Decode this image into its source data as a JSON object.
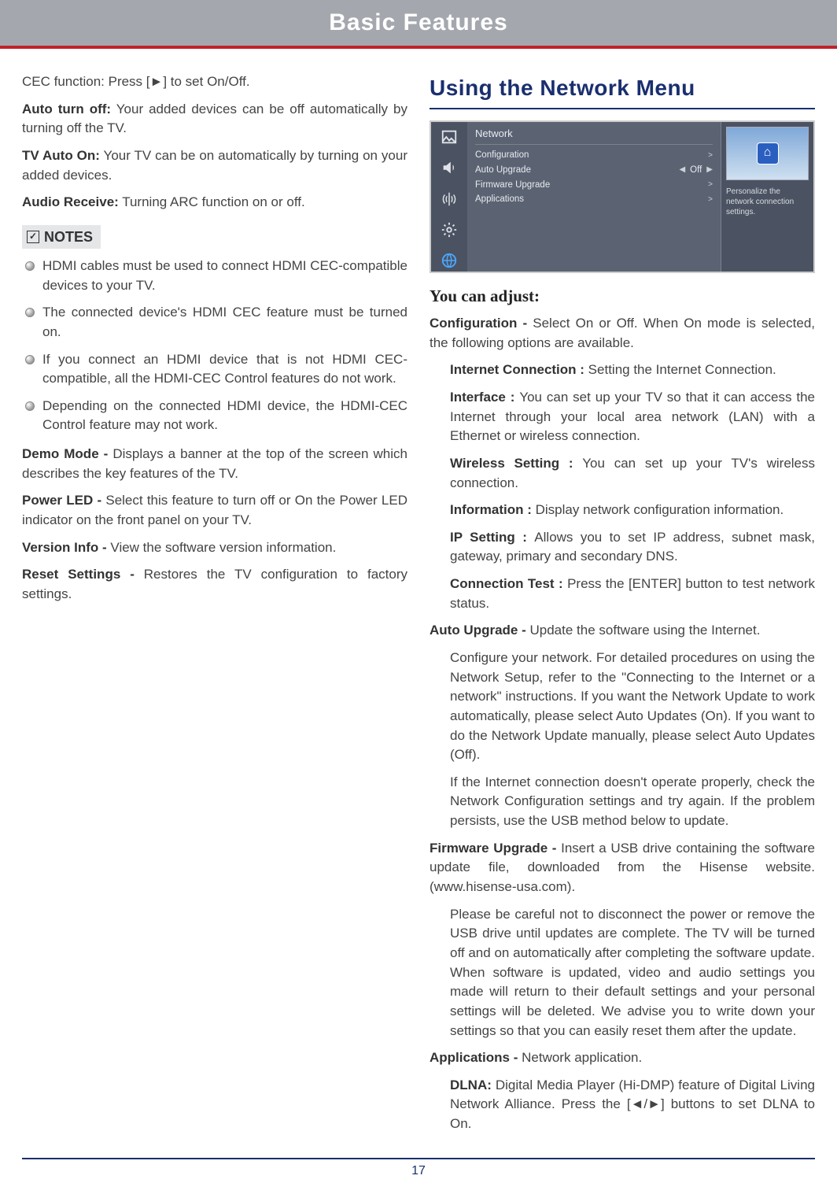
{
  "header": {
    "title": "Basic Features"
  },
  "left": {
    "cec_intro": "CEC function: Press [►] to set On/Off.",
    "auto_turn_off_label": "Auto turn off:",
    "auto_turn_off_text": " Your added devices can be off automatically by turning off the TV.",
    "tv_auto_on_label": "TV Auto On:",
    "tv_auto_on_text": " Your TV can be on automatically by turning on your added devices.",
    "audio_receive_label": "Audio Receive:",
    "audio_receive_text": " Turning ARC function on or off.",
    "notes_label": "NOTES",
    "bullets": [
      "HDMI cables must be used to connect HDMI CEC-compatible devices to your TV.",
      "The connected device's HDMI CEC feature must be turned on.",
      "If you connect an HDMI device that is not HDMI CEC-compatible, all the HDMI-CEC Control features do not work.",
      "Depending on the connected HDMI device, the HDMI-CEC Control feature may not work."
    ],
    "demo_mode_label": "Demo Mode - ",
    "demo_mode_text": "Displays a banner at the top of the screen which describes the key features of the TV.",
    "power_led_label": "Power LED - ",
    "power_led_text": "Select this feature to turn off or On the Power LED indicator on the front panel on your TV.",
    "version_info_label": "Version Info - ",
    "version_info_text": "View the software version information.",
    "reset_settings_label": "Reset Settings - ",
    "reset_settings_text": "Restores the TV configuration to factory settings."
  },
  "right": {
    "section_title": "Using the Network Menu",
    "menu": {
      "title": "Network",
      "rows": [
        {
          "label": "Configuration",
          "value": "",
          "chev": ">"
        },
        {
          "label": "Auto Upgrade",
          "value": "Off",
          "chev": "▶",
          "left_chev": "◀"
        },
        {
          "label": "Firmware Upgrade",
          "value": "",
          "chev": ">"
        },
        {
          "label": "Applications",
          "value": "",
          "chev": ">"
        }
      ],
      "hint": "Personalize the network connection settings."
    },
    "subhead": "You can adjust:",
    "configuration_label": "Configuration - ",
    "configuration_text": "Select On or Off. When On mode is selected, the following options are available.",
    "internet_conn_label": "Internet Connection : ",
    "internet_conn_text": "Setting the Internet Connection.",
    "interface_label": "Interface : ",
    "interface_text": "You can set up your TV so that it can access the Internet through your local area network (LAN) with a Ethernet or wireless connection.",
    "wireless_label": "Wireless Setting : ",
    "wireless_text": "You can set up your TV's wireless connection.",
    "information_label": "Information : ",
    "information_text": "Display network configuration information.",
    "ip_label": "IP Setting : ",
    "ip_text": "Allows you to set IP address, subnet mask, gateway, primary and secondary DNS.",
    "conntest_label": "Connection Test : ",
    "conntest_text": "Press the [ENTER] button to test network status.",
    "autoupgrade_label": "Auto Upgrade - ",
    "autoupgrade_text": "Update the software using the Internet.",
    "autoupgrade_detail1": "Configure your network. For detailed procedures on using the Network Setup, refer to the \"Connecting to the Internet or a network\" instructions. If you want the Network Update to work automatically, please select Auto Updates (On). If you want to do the Network Update manually, please select Auto Updates (Off).",
    "autoupgrade_detail2": "If the Internet connection doesn't operate properly, check the Network Configuration settings and try again. If the problem persists, use the USB method below to update.",
    "firmware_label": "Firmware Upgrade - ",
    "firmware_text": "Insert a USB drive containing the software update file, downloaded from the Hisense website. (www.hisense-usa.com).",
    "firmware_detail": "Please be careful not to disconnect the power or remove the USB drive until updates are complete. The TV will be turned off and on automatically after completing the software update. When software is updated, video and audio settings you made will return to their default settings and your personal settings will be deleted. We advise you to write down your settings so that you can easily reset them after the update.",
    "applications_label": "Applications - ",
    "applications_text": "Network application.",
    "dlna_label": "DLNA: ",
    "dlna_text": "Digital Media Player (Hi-DMP) feature of Digital Living Network Alliance. Press the [◄/►] buttons to set DLNA to On."
  },
  "footer": {
    "page_number": "17"
  }
}
